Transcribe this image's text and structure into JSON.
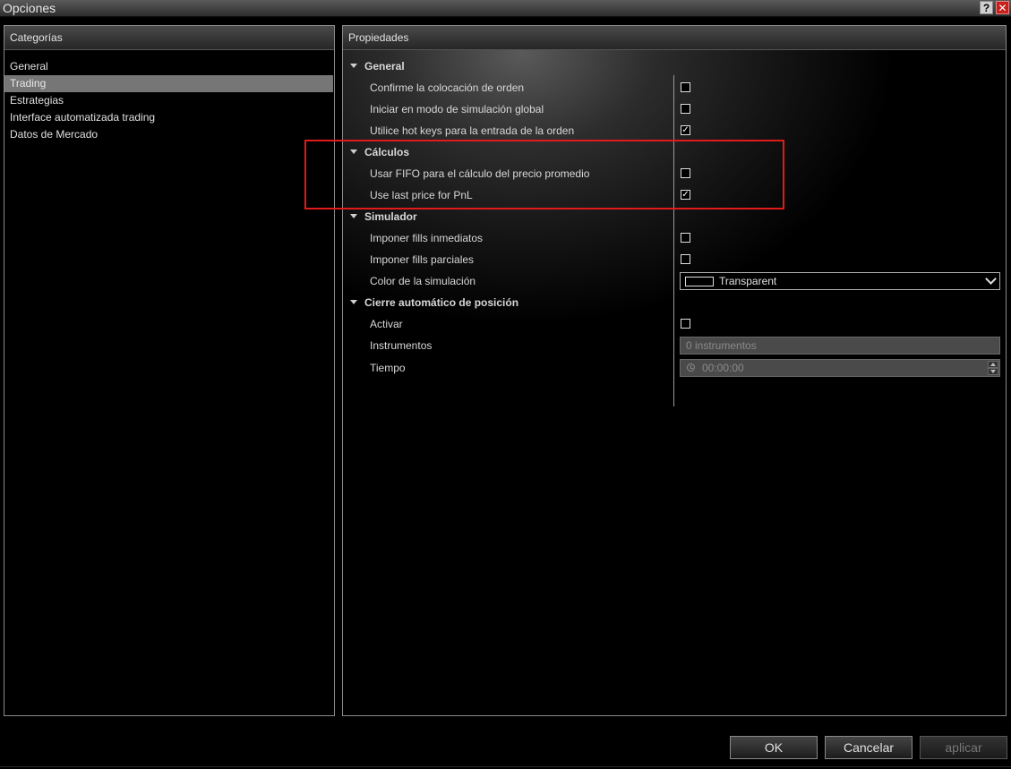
{
  "window": {
    "title": "Opciones",
    "help_label": "?",
    "close_label": "✕"
  },
  "categories": {
    "header": "Categorías",
    "items": [
      {
        "label": "General"
      },
      {
        "label": "Trading",
        "selected": true
      },
      {
        "label": "Estrategias"
      },
      {
        "label": "Interface automatizada trading"
      },
      {
        "label": "Datos de Mercado"
      }
    ]
  },
  "properties": {
    "header": "Propiedades",
    "groups": {
      "general": {
        "label": "General",
        "confirm_order": {
          "label": "Confirme la colocación de orden",
          "checked": false
        },
        "start_sim": {
          "label": "Iniciar en modo de simulación global",
          "checked": false
        },
        "hot_keys": {
          "label": "Utilice hot keys para la entrada de la orden",
          "checked": true
        }
      },
      "calculos": {
        "label": "Cálculos",
        "use_fifo": {
          "label": "Usar FIFO para el cálculo del precio promedio",
          "checked": false
        },
        "last_price_pnl": {
          "label": "Use last price for PnL",
          "checked": true
        }
      },
      "simulador": {
        "label": "Simulador",
        "fills_inmediatos": {
          "label": "Imponer fills inmediatos",
          "checked": false
        },
        "fills_parciales": {
          "label": "Imponer fills parciales",
          "checked": false
        },
        "color_sim": {
          "label": "Color de la simulación",
          "value": "Transparent"
        }
      },
      "cierre": {
        "label": "Cierre automático de posición",
        "activar": {
          "label": "Activar",
          "checked": false
        },
        "instrumentos": {
          "label": "Instrumentos",
          "value": "0 instrumentos"
        },
        "tiempo": {
          "label": "Tiempo",
          "value": "00:00:00"
        }
      }
    }
  },
  "buttons": {
    "ok": "OK",
    "cancel": "Cancelar",
    "apply": "aplicar"
  },
  "colors": {
    "highlight": "#e01b1b",
    "selected_row": "#767676",
    "close_button": "#c8201a"
  }
}
